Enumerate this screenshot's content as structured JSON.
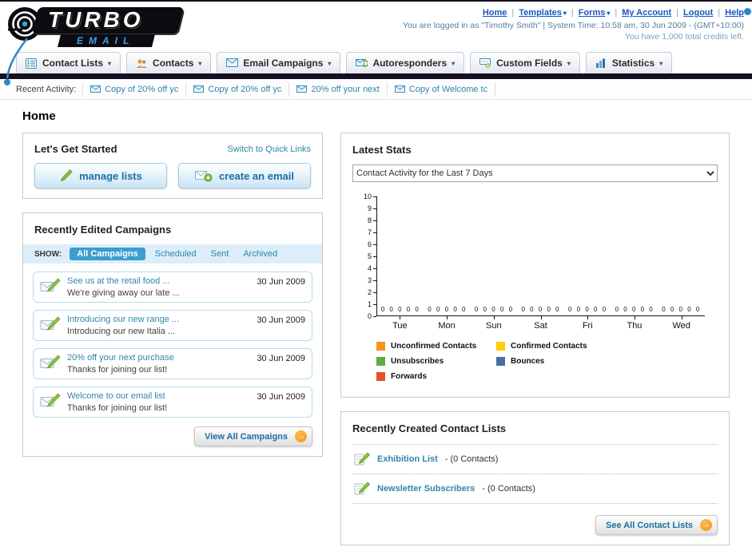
{
  "brand": {
    "line1": "TURBO",
    "line2": "EMAIL"
  },
  "header": {
    "links": [
      {
        "label": "Home",
        "caret": false
      },
      {
        "label": "Templates",
        "caret": true
      },
      {
        "label": "Forms",
        "caret": true
      },
      {
        "label": "My Account",
        "caret": false
      },
      {
        "label": "Logout",
        "caret": false
      },
      {
        "label": "Help",
        "caret": false
      }
    ],
    "session_line": "You are logged in as \"Timothy Smith\" | System Time: 10:58 am, 30 Jun 2009 - (GMT+10:00)",
    "credits_line": "You have 1,000 total credits left."
  },
  "mainnav": {
    "items": [
      {
        "label": "Contact Lists",
        "icon": "contact-lists-icon"
      },
      {
        "label": "Contacts",
        "icon": "contacts-icon"
      },
      {
        "label": "Email Campaigns",
        "icon": "email-campaigns-icon"
      },
      {
        "label": "Autoresponders",
        "icon": "autoresponders-icon"
      },
      {
        "label": "Custom Fields",
        "icon": "custom-fields-icon"
      },
      {
        "label": "Statistics",
        "icon": "statistics-icon"
      }
    ]
  },
  "recent_activity": {
    "label": "Recent Activity:",
    "items": [
      "Copy of 20% off yc",
      "Copy of 20% off yc",
      "20% off your next",
      "Copy of Welcome tc"
    ]
  },
  "page_title": "Home",
  "get_started": {
    "title": "Let's Get Started",
    "switch_link": "Switch to Quick Links",
    "manage_lists": "manage lists",
    "create_email": "create an email"
  },
  "campaigns": {
    "title": "Recently Edited Campaigns",
    "show_label": "SHOW:",
    "tabs": [
      "All Campaigns",
      "Scheduled",
      "Sent",
      "Archived"
    ],
    "active_tab": "All Campaigns",
    "items": [
      {
        "title": "See us at the retail food ...",
        "subtitle": "We're giving away our late ...",
        "date": "30 Jun 2009"
      },
      {
        "title": "Introducing our new range ...",
        "subtitle": "Introducing our new Italia ...",
        "date": "30 Jun 2009"
      },
      {
        "title": "20% off your next purchase",
        "subtitle": "Thanks for joining our list!",
        "date": "30 Jun 2009"
      },
      {
        "title": "Welcome to our email list",
        "subtitle": "Thanks for joining our list!",
        "date": "30 Jun 2009"
      }
    ],
    "view_all_label": "View All Campaigns"
  },
  "stats": {
    "title": "Latest Stats",
    "filter_value": "Contact Activity for the Last 7 Days"
  },
  "chart_data": {
    "type": "bar",
    "title": "Contact Activity for the Last 7 Days",
    "categories": [
      "Tue",
      "Mon",
      "Sun",
      "Sat",
      "Fri",
      "Thu",
      "Wed"
    ],
    "series": [
      {
        "name": "Unconfirmed Contacts",
        "color": "#f7941d",
        "values": [
          0,
          0,
          0,
          0,
          0,
          0,
          0
        ]
      },
      {
        "name": "Confirmed Contacts",
        "color": "#ffcc00",
        "values": [
          0,
          0,
          0,
          0,
          0,
          0,
          0
        ]
      },
      {
        "name": "Unsubscribes",
        "color": "#5fad41",
        "values": [
          0,
          0,
          0,
          0,
          0,
          0,
          0
        ]
      },
      {
        "name": "Bounces",
        "color": "#4a6da7",
        "values": [
          0,
          0,
          0,
          0,
          0,
          0,
          0
        ]
      },
      {
        "name": "Forwards",
        "color": "#e8502e",
        "values": [
          0,
          0,
          0,
          0,
          0,
          0,
          0
        ]
      }
    ],
    "ylim": [
      0,
      10
    ],
    "yticks": [
      10,
      9,
      8,
      7,
      6,
      5,
      4,
      3,
      2,
      1,
      0
    ],
    "grid": false,
    "legend_position": "bottom",
    "value_labels_shown": true
  },
  "contact_lists": {
    "title": "Recently Created Contact Lists",
    "items": [
      {
        "name": "Exhibition List",
        "detail": "- (0 Contacts)"
      },
      {
        "name": "Newsletter Subscribers",
        "detail": "- (0 Contacts)"
      }
    ],
    "see_all_label": "See All Contact Lists"
  },
  "colors": {
    "accent_teal": "#2e86ab",
    "link_blue": "#1757c2",
    "active_tab_bg": "#3d9cd2",
    "arrow_orange": "#f7941d",
    "nav_dark_bar": "#161120"
  }
}
